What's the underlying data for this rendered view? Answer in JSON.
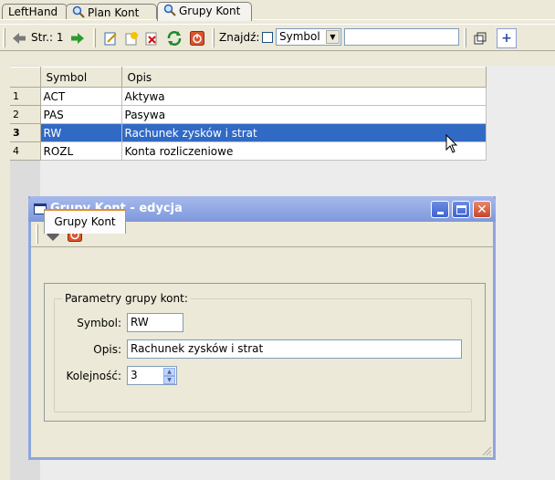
{
  "tabs": [
    {
      "label": "LeftHand",
      "icon": "none"
    },
    {
      "label": "Plan Kont",
      "icon": "magnifier-icon"
    },
    {
      "label": "Grupy Kont",
      "icon": "magnifier-icon"
    }
  ],
  "toolbar": {
    "page_label": "Str.: 1",
    "find_label": "Znajdź:",
    "find_field": "Symbol",
    "find_value": ""
  },
  "grid": {
    "columns": [
      "Symbol",
      "Opis"
    ],
    "rows": [
      {
        "num": "1",
        "symbol": "ACT",
        "opis": "Aktywa"
      },
      {
        "num": "2",
        "symbol": "PAS",
        "opis": "Pasywa"
      },
      {
        "num": "3",
        "symbol": "RW",
        "opis": "Rachunek zysków i strat"
      },
      {
        "num": "4",
        "symbol": "ROZL",
        "opis": "Konta rozliczeniowe"
      }
    ],
    "selected_row": 3
  },
  "dialog": {
    "title": "Grupy Kont - edycja",
    "tab_label": "Grupy Kont",
    "groupbox_title": "Parametry grupy kont:",
    "fields": {
      "symbol_label": "Symbol:",
      "symbol_value": "RW",
      "opis_label": "Opis:",
      "opis_value": "Rachunek zysków i strat",
      "kolejnosc_label": "Kolejność:",
      "kolejnosc_value": "3"
    }
  },
  "colors": {
    "selection": "#316ac5",
    "title_bar": "#8ea6e3",
    "window_bg": "#ece9d8"
  }
}
